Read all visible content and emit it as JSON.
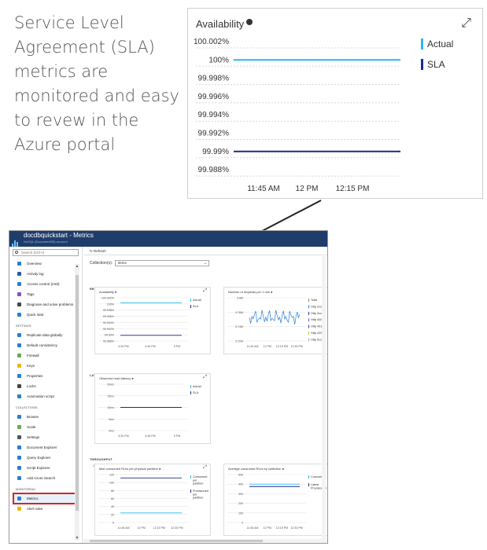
{
  "caption": "Service Level Agreement (SLA) metrics are monitored and easy to revew in the Azure portal",
  "zoom": {
    "title": "Availability",
    "expand_icon": "expand-icon",
    "y_ticks": [
      "100.002%",
      "100%",
      "99.998%",
      "99.996%",
      "99.994%",
      "99.992%",
      "99.99%",
      "99.988%"
    ],
    "x_ticks": [
      "11:45 AM",
      "12 PM",
      "12:15 PM"
    ],
    "legend": [
      {
        "name": "Actual",
        "color": "#29b6f0"
      },
      {
        "name": "SLA",
        "color": "#1a2a8c"
      }
    ]
  },
  "chart_data": {
    "type": "line",
    "title": "Availability",
    "ylim": [
      99.988,
      100.002
    ],
    "x": [
      "11:45 AM",
      "12 PM",
      "12:15 PM"
    ],
    "series": [
      {
        "name": "Actual",
        "values": [
          100,
          100,
          100
        ]
      },
      {
        "name": "SLA",
        "values": [
          99.99,
          99.99,
          99.99
        ]
      }
    ]
  },
  "portal": {
    "header_title": "docdbquickstart - Metrics",
    "header_subtitle": "NoSQL (DocumentDB) account",
    "search_placeholder": "Search (Ctrl+/)",
    "toolbar_refresh": "Refresh",
    "collections_label": "Collection(s):",
    "collections_value": "items",
    "sidebar": {
      "top": [
        {
          "label": "Overview",
          "color": "#2a7fd4"
        },
        {
          "label": "Activity log",
          "color": "#2a5aa8"
        },
        {
          "label": "Access control (IAM)",
          "color": "#2a7fd4"
        },
        {
          "label": "Tags",
          "color": "#8a4fc4"
        },
        {
          "label": "Diagnose and solve problems",
          "color": "#444444"
        },
        {
          "label": "Quick start",
          "color": "#2a7fd4"
        }
      ],
      "settings_label": "SETTINGS",
      "settings": [
        {
          "label": "Replicate data globally",
          "color": "#2a7fd4"
        },
        {
          "label": "Default consistency",
          "color": "#2a7fd4"
        },
        {
          "label": "Firewall",
          "color": "#6aa84f"
        },
        {
          "label": "Keys",
          "color": "#e6b800"
        },
        {
          "label": "Properties",
          "color": "#2a7fd4"
        },
        {
          "label": "Locks",
          "color": "#444444"
        },
        {
          "label": "Automation script",
          "color": "#2a7fd4"
        }
      ],
      "collections_label": "COLLECTIONS",
      "collections": [
        {
          "label": "Browse",
          "color": "#2a7fd4"
        },
        {
          "label": "Scale",
          "color": "#6aa84f"
        },
        {
          "label": "Settings",
          "color": "#555555"
        },
        {
          "label": "Document Explorer",
          "color": "#2a7fd4"
        },
        {
          "label": "Query Explorer",
          "color": "#2a7fd4"
        },
        {
          "label": "Script Explorer",
          "color": "#2a7fd4"
        },
        {
          "label": "Add Azure Search",
          "color": "#2a7fd4"
        }
      ],
      "monitoring_label": "MONITORING",
      "monitoring": [
        {
          "label": "Metrics",
          "color": "#2a7fd4",
          "active": true
        },
        {
          "label": "Alert rules",
          "color": "#e6b800"
        }
      ]
    },
    "sections": {
      "requests": "REQUESTS AND AVAILABILITY",
      "latency": "LATENCY",
      "throughput": "THROUGHPUT",
      "throughput_sub": "Collection items has 1 physical partitions"
    },
    "charts": {
      "availability": {
        "title": "Availability",
        "y_ticks": [
          "100.002%",
          "100%",
          "99.998%",
          "99.996%",
          "99.994%",
          "99.992%",
          "99.99%",
          "99.988%"
        ],
        "x_ticks": [
          "4:30 PM",
          "4:45 PM",
          "5 PM"
        ],
        "legend": [
          "Actual",
          "SLA"
        ]
      },
      "requests": {
        "title": "Number of requests per 1 min",
        "y_ticks": [
          "3.8M",
          "3.76M",
          "3.74M",
          "3.72M"
        ],
        "x_ticks": [
          "11:45 AM",
          "12 PM",
          "12:15 PM",
          "12:30 PM"
        ],
        "legend": [
          "Total",
          "Http 2xx",
          "Http 3xx",
          "Http 400",
          "Http 401",
          "Http 429",
          "Http 5xx"
        ],
        "legend_colors": [
          "#6aa84f",
          "#2a7fd4",
          "#1a2a8c",
          "#8a4fc4",
          "#5a2a8a",
          "#b5d334",
          "#aaaaaa"
        ]
      },
      "latency": {
        "title": "Observed read latency",
        "y_ticks": [
          "20ms",
          "15ms",
          "10ms",
          "5ms",
          "0ms"
        ],
        "x_ticks": [
          "4:30 PM",
          "4:45 PM",
          "5 PM"
        ],
        "legend": [
          "Actual",
          "SLA"
        ]
      },
      "ru_partition": {
        "title": "Max consumed RU/s per physical partition",
        "y_ticks": [
          "120",
          "100",
          "80",
          "60",
          "40",
          "20",
          "0"
        ],
        "x_ticks": [
          "11:45 AM",
          "12 PM",
          "12:15 PM",
          "12:30 PM"
        ],
        "legend": [
          "Consumed per partition",
          "Provisioned per partition"
        ]
      },
      "ru_collection": {
        "title": "Average consumed RU/s by collection",
        "y_ticks": [
          "500",
          "400",
          "300",
          "200",
          "100",
          "0"
        ],
        "x_ticks": [
          "11:45 AM",
          "12 PM",
          "12:15 PM",
          "12:30 PM"
        ],
        "legend": [
          "Consumed",
          "Latest Provisioned"
        ]
      }
    }
  }
}
